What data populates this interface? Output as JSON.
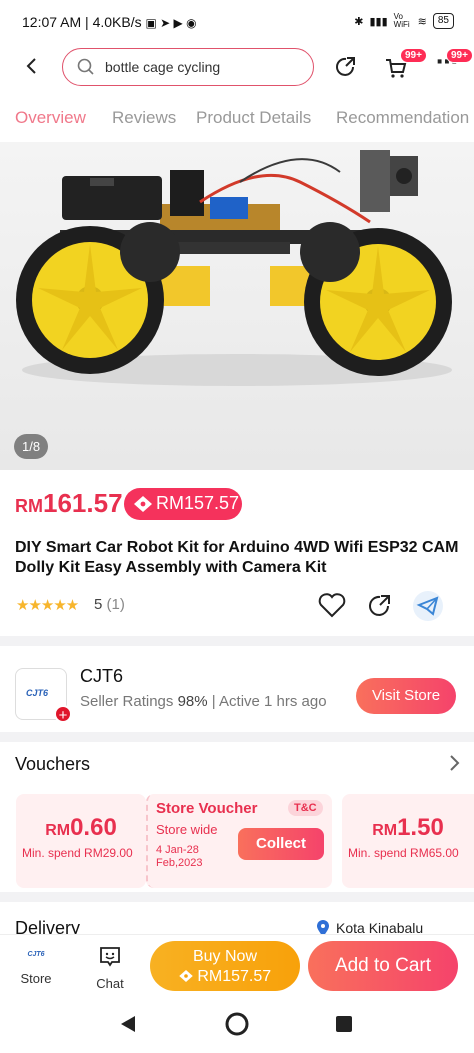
{
  "status": {
    "time": "12:07 AM",
    "speed": "4.0KB/s",
    "battery": "85",
    "vowifi": "Vo WiFi"
  },
  "search": {
    "query": "bottle cage cycling"
  },
  "header": {
    "cart_badge": "99+",
    "more_badge": "99+"
  },
  "tabs": [
    "Overview",
    "Reviews",
    "Product Details",
    "Recommendation"
  ],
  "gallery": {
    "pager": "1/8"
  },
  "product": {
    "currency": "RM",
    "price": "161.57",
    "voucher_price": "RM157.57",
    "title": "DIY Smart Car Robot Kit for Arduino 4WD Wifi ESP32 CAM Dolly Kit Easy Assembly with Camera Kit",
    "stars": "★★★★★",
    "rating": "5",
    "review_count": "(1)"
  },
  "seller": {
    "name": "CJT6",
    "logo_text": "CJT6",
    "ratings_label": "Seller Ratings",
    "ratings_value": "98%",
    "active": "Active 1 hrs ago",
    "visit_label": "Visit Store"
  },
  "vouchers": {
    "heading": "Vouchers",
    "items": [
      {
        "currency": "RM",
        "amount": "0.60",
        "min_spend": "Min. spend RM29.00"
      },
      {
        "title": "Store Voucher",
        "subtitle": "Store wide",
        "tag": "T&C",
        "dates": "4 Jan-28 Feb,2023",
        "collect_label": "Collect"
      },
      {
        "currency": "RM",
        "amount": "1.50",
        "min_spend": "Min. spend RM65.00"
      }
    ]
  },
  "delivery": {
    "heading": "Delivery",
    "location": "Kota Kinabalu"
  },
  "bottom": {
    "store_label": "Store",
    "chat_label": "Chat",
    "buy_now": "Buy Now",
    "buy_now_price": "RM157.57",
    "add_to_cart": "Add to Cart"
  },
  "colors": {
    "accent": "#f5325c",
    "tab_active": "#f0788a",
    "buy_now": "#f8a10a",
    "star": "#f7b52c"
  }
}
